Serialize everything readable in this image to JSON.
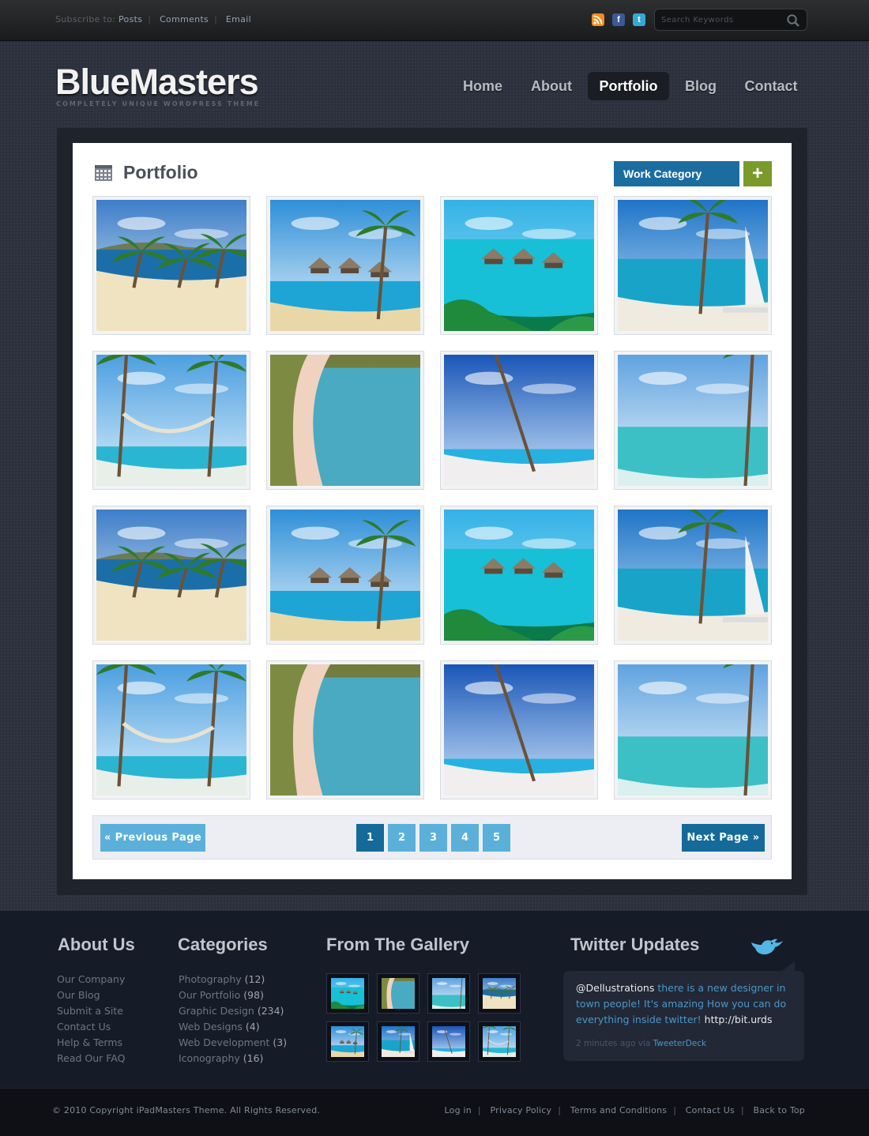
{
  "topbar": {
    "subscribe_label": "Subscribe to:",
    "links": [
      "Posts",
      "Comments",
      "Email"
    ],
    "search_placeholder": "Search Keywords",
    "social": [
      "rss-icon",
      "facebook-icon",
      "twitter-icon"
    ]
  },
  "header": {
    "logo": "BlueMasters",
    "tagline": "COMPLETELY UNIQUE WORDPRESS THEME",
    "nav": [
      "Home",
      "About",
      "Portfolio",
      "Blog",
      "Contact"
    ],
    "active_nav": "Portfolio"
  },
  "main": {
    "title": "Portfolio",
    "work_category": "Work Category",
    "add_icon": "plus-icon",
    "gallery": [
      "beach-bay",
      "island-palm",
      "water-huts",
      "sailboat-palm",
      "hammock-palm",
      "sand-cove",
      "leaning-palm",
      "tropical-shore",
      "beach-bay",
      "island-palm",
      "water-huts",
      "sailboat-palm",
      "hammock-palm",
      "sand-cove",
      "leaning-palm",
      "tropical-shore"
    ],
    "pagination": {
      "prev": "« Previous Page",
      "next": "Next Page »",
      "pages": [
        "1",
        "2",
        "3",
        "4",
        "5"
      ],
      "current": "1"
    }
  },
  "footer": {
    "about": {
      "title": "About Us",
      "items": [
        "Our Company",
        "Our Blog",
        "Submit a Site",
        "Contact Us",
        "Help & Terms",
        "Read Our FAQ"
      ]
    },
    "categories": {
      "title": "Categories",
      "items": [
        {
          "name": "Photography",
          "count": "(12)"
        },
        {
          "name": "Our Portfolio",
          "count": "(98)"
        },
        {
          "name": "Graphic Design",
          "count": "(234)"
        },
        {
          "name": "Web Designs",
          "count": "(4)"
        },
        {
          "name": "Web Development",
          "count": "(3)"
        },
        {
          "name": "Iconography",
          "count": "(16)"
        }
      ]
    },
    "gallery": {
      "title": "From The Gallery",
      "items": [
        "hut-thumb",
        "lagoon-thumb",
        "shore-thumb",
        "coast-thumb",
        "cliff-thumb",
        "reef-thumb",
        "palm-thumb",
        "beach-thumb"
      ]
    },
    "twitter": {
      "title": "Twitter Updates",
      "user": "@Dellustrations",
      "text": " there is a new designer in town people! It's amazing How you can do everything inside twitter! ",
      "link": "http://bit.urds",
      "meta": "2 minutes ago via ",
      "source": "TweeterDeck"
    }
  },
  "bottom": {
    "copyright": "© 2010 Copyright iPadMasters Theme. All Rights Reserved.",
    "links": [
      "Log in",
      "Privacy Policy",
      "Terms and Conditions",
      "Contact Us",
      "Back to Top"
    ]
  },
  "colors": {
    "accent": "#146a99",
    "accent_light": "#5bb0da",
    "add_button": "#7a9a2a"
  }
}
